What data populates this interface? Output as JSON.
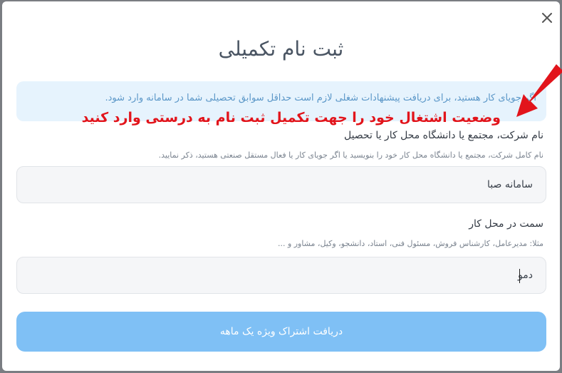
{
  "modal": {
    "title": "ثبت نام تکمیلی",
    "info_text": "اگر جویای کار هستید، برای دریافت پیشنهادات شغلی لازم است حداقل سوابق تحصیلی شما در سامانه وارد شود.",
    "annotation_text": "وضعیت اشتغال خود را جهت تکمیل ثبت نام به درستی وارد کنید",
    "company_field": {
      "label": "نام شرکت، مجتمع یا دانشگاه محل کار یا تحصیل",
      "hint": "نام کامل شرکت، مجتمع یا دانشگاه محل کار خود را بنویسید یا اگر جویای کار یا فعال مستقل صنعتی هستید، ذکر نمایید.",
      "value": "سامانه صبا"
    },
    "position_field": {
      "label": "سمت در محل کار",
      "hint": "مثلا: مدیرعامل، کارشناس فروش، مسئول فنی، استاد، دانشجو، وکیل، مشاور و ...",
      "value": "دمو"
    },
    "submit_label": "دریافت اشتراک ویژه یک ماهه"
  },
  "colors": {
    "accent": "#7fc0f5",
    "info_bg": "#e6f3fd",
    "annotation": "#e2141b"
  },
  "icons": {
    "close": "close-icon",
    "arrow": "red-arrow-icon"
  }
}
